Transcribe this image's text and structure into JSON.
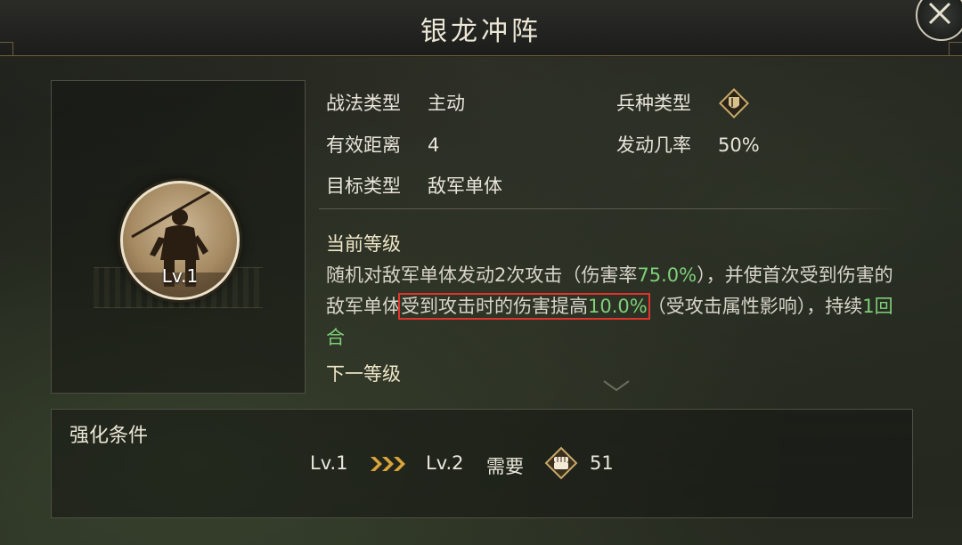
{
  "window": {
    "title": "银龙冲阵"
  },
  "portrait": {
    "level": "Lv.1"
  },
  "stats": {
    "tactic_type_key": "战法类型",
    "tactic_type_val": "主动",
    "range_key": "有效距离",
    "range_val": "4",
    "target_key": "目标类型",
    "target_val": "敌军单体",
    "troop_key": "兵种类型",
    "troop_icon": "shield-icon",
    "rate_key": "发动几率",
    "rate_val": "50%"
  },
  "current_level": {
    "label": "当前等级",
    "d1": "随机对敌军单体发动2次攻击（伤害率",
    "d2": "75.0%",
    "d3": "），并使首次受到伤害的敌军单体",
    "d4": "受到攻击时的伤害提高",
    "d5": "10.0%",
    "d6": "（受攻击属性影响），持续",
    "d7": "1回合"
  },
  "next_level": {
    "label": "下一等级"
  },
  "upgrade": {
    "title": "强化条件",
    "from": "Lv.1",
    "to": "Lv.2",
    "need": "需要",
    "amount": "51",
    "currency_icon": "fist-icon"
  },
  "colors": {
    "highlight": "#7fcf7a",
    "box": "#e0352b",
    "gold": "#c9a96a"
  }
}
